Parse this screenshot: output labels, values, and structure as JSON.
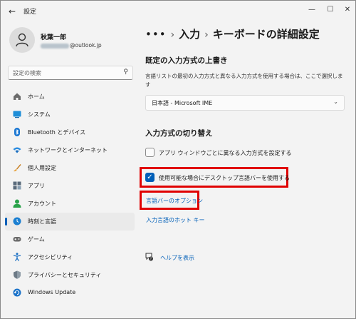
{
  "app": {
    "title": "設定"
  },
  "icons": {
    "back": "arrow-left-icon",
    "minimize": "minimize-icon",
    "maximize": "maximize-icon",
    "close": "close-icon"
  },
  "user": {
    "name": "秋葉一郎",
    "email_visible": "@outlook.jp"
  },
  "search": {
    "placeholder": "設定の検索"
  },
  "sidebar": {
    "items": [
      {
        "label": "ホーム",
        "icon": "home-icon",
        "selected": false
      },
      {
        "label": "システム",
        "icon": "display-icon",
        "selected": false
      },
      {
        "label": "Bluetooth とデバイス",
        "icon": "bluetooth-icon",
        "selected": false
      },
      {
        "label": "ネットワークとインターネット",
        "icon": "wifi-icon",
        "selected": false
      },
      {
        "label": "個人用設定",
        "icon": "brush-icon",
        "selected": false
      },
      {
        "label": "アプリ",
        "icon": "apps-icon",
        "selected": false
      },
      {
        "label": "アカウント",
        "icon": "account-icon",
        "selected": false
      },
      {
        "label": "時刻と言語",
        "icon": "globe-clock-icon",
        "selected": true
      },
      {
        "label": "ゲーム",
        "icon": "gamepad-icon",
        "selected": false
      },
      {
        "label": "アクセシビリティ",
        "icon": "accessibility-icon",
        "selected": false
      },
      {
        "label": "プライバシーとセキュリティ",
        "icon": "shield-icon",
        "selected": false
      },
      {
        "label": "Windows Update",
        "icon": "update-icon",
        "selected": false
      }
    ]
  },
  "breadcrumb": {
    "dots": "•••",
    "parent": "入力",
    "current": "キーボードの詳細設定"
  },
  "main": {
    "default_input": {
      "title": "既定の入力方式の上書き",
      "description": "言語リストの最初の入力方式と異なる入力方式を使用する場合は、ここで選択します",
      "dropdown_value": "日本語 - Microsoft IME"
    },
    "switching": {
      "title": "入力方式の切り替え",
      "per_app_label": "アプリ ウィンドウごとに異なる入力方式を設定する",
      "per_app_checked": false,
      "desktop_bar_label": "使用可能な場合にデスクトップ言語バーを使用する",
      "desktop_bar_checked": true,
      "options_link": "言語バーのオプション",
      "hotkeys_link": "入力言語のホット キー"
    },
    "help_link": "ヘルプを表示"
  },
  "colors": {
    "accent": "#005fb8",
    "highlight_box": "#e00000"
  }
}
